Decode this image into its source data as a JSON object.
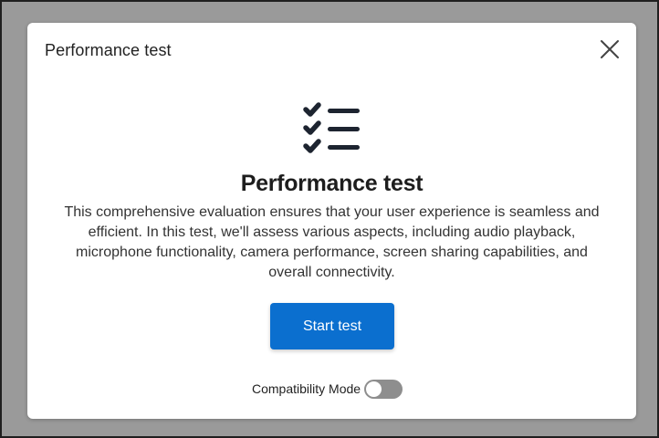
{
  "dialog": {
    "header_title": "Performance test",
    "close_icon": "close-icon",
    "hero_icon": "checklist-icon",
    "title": "Performance test",
    "description": "This comprehensive evaluation ensures that your user experience is seamless and efficient. In this test, we'll assess various aspects, including audio playback, microphone functionality, camera performance, screen sharing capabilities, and overall connectivity.",
    "start_button_label": "Start test",
    "compatibility_label": "Compatibility Mode",
    "compatibility_enabled": false
  },
  "colors": {
    "backdrop": "#9a9a9a",
    "primary": "#0b6fcf",
    "toggle_off": "#8e8e8e",
    "icon_dark": "#1d2430"
  }
}
